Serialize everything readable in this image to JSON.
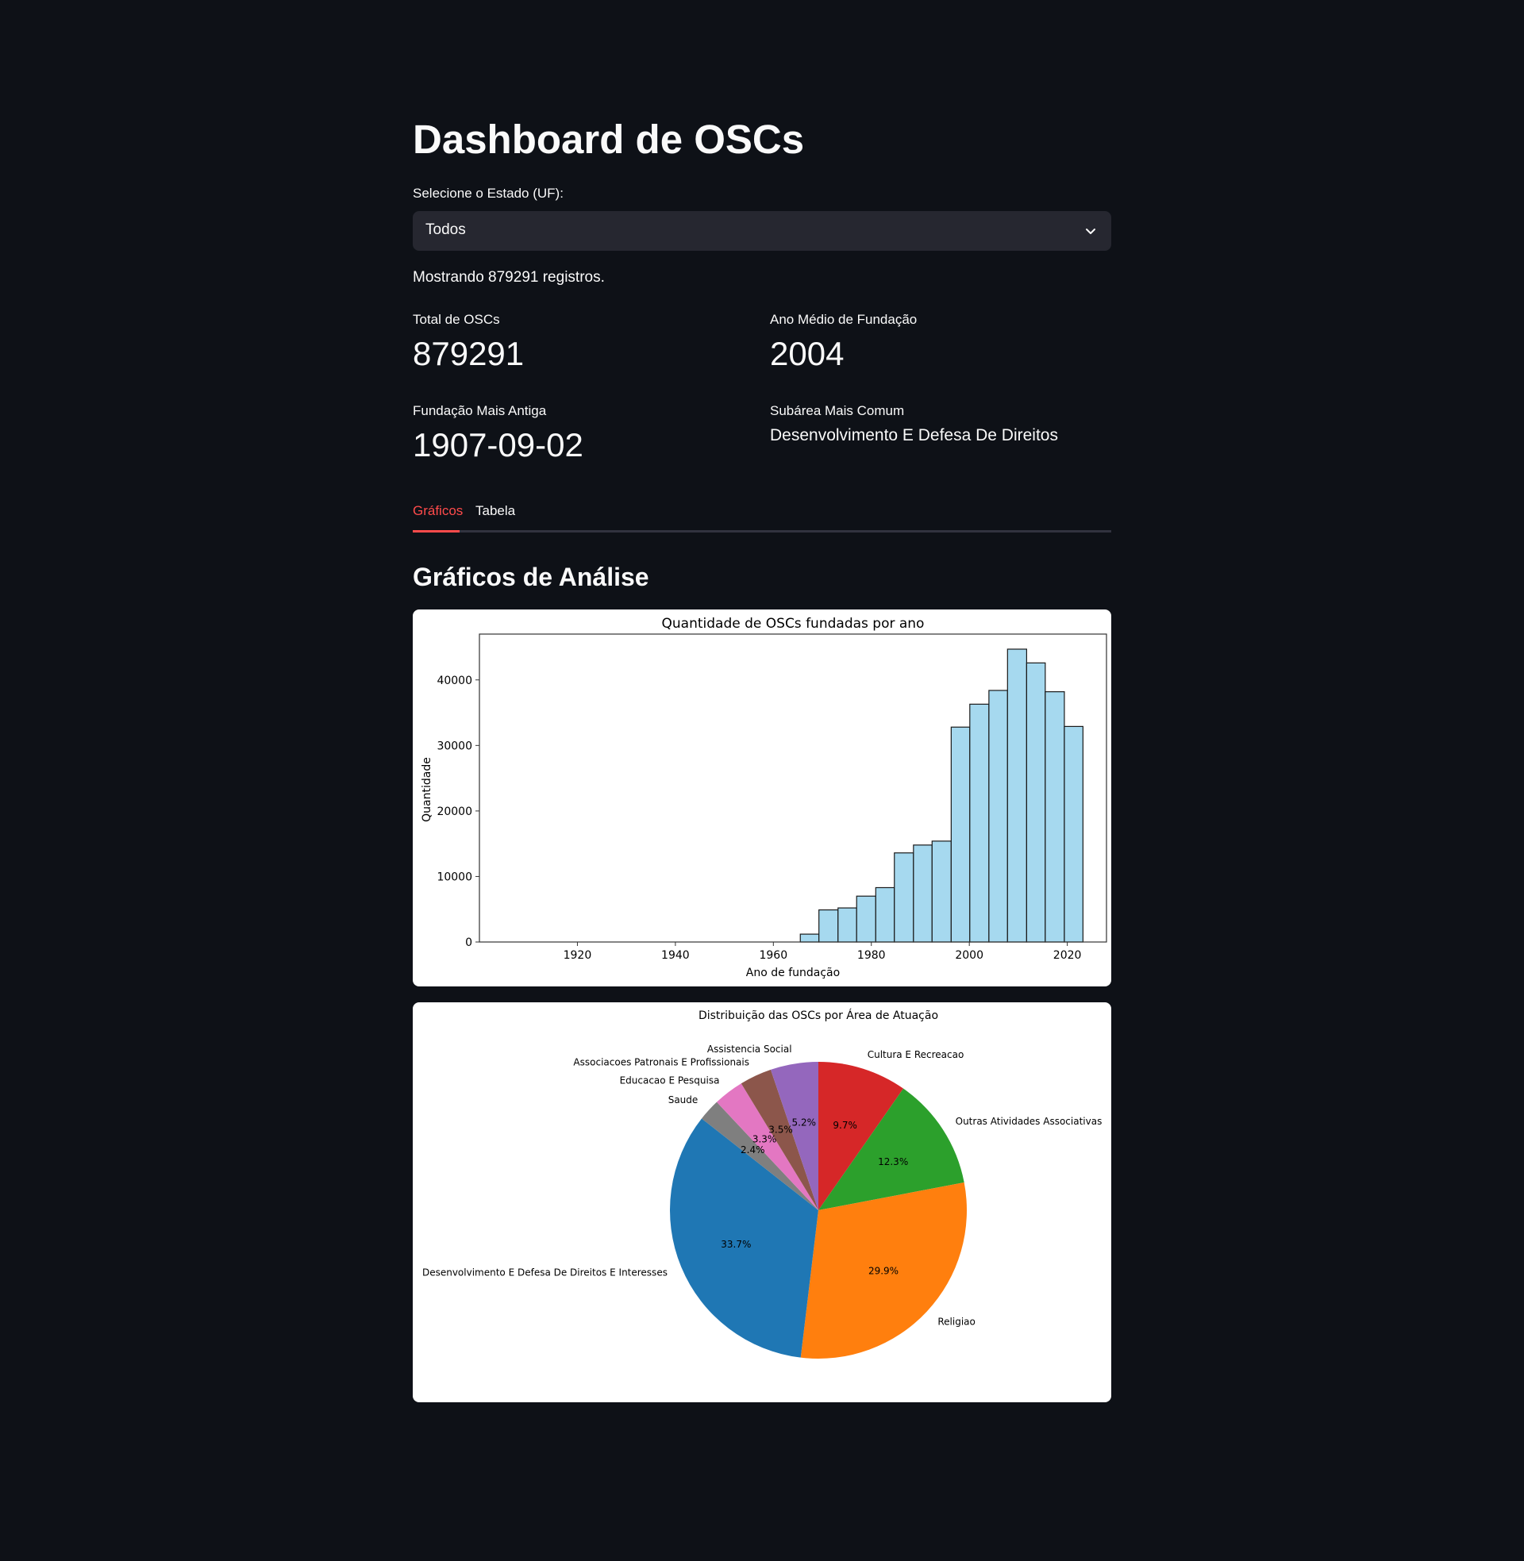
{
  "app": {
    "title": "Dashboard de OSCs"
  },
  "filter": {
    "label": "Selecione o Estado (UF):",
    "selected": "Todos"
  },
  "records_text": "Mostrando 879291 registros.",
  "metrics": {
    "total": {
      "label": "Total de OSCs",
      "value": "879291"
    },
    "avg_year": {
      "label": "Ano Médio de Fundação",
      "value": "2004"
    },
    "oldest": {
      "label": "Fundação Mais Antiga",
      "value": "1907-09-02"
    },
    "top_subarea": {
      "label": "Subárea Mais Comum",
      "value": "Desenvolvimento E Defesa De Direitos"
    }
  },
  "tabs": [
    {
      "label": "Gráficos",
      "active": true
    },
    {
      "label": "Tabela",
      "active": false
    }
  ],
  "section_title": "Gráficos de Análise",
  "colors": {
    "background": "#0e1117",
    "accent": "#ff4b4b",
    "select_bg": "#262730",
    "hist_bar": "#a6d9ef"
  },
  "chart_data": [
    {
      "type": "bar",
      "title": "Quantidade de OSCs fundadas por ano",
      "xlabel": "Ano de fundação",
      "ylabel": "Quantidade",
      "xlim": [
        1900,
        2028
      ],
      "ylim": [
        0,
        47000
      ],
      "xticks": [
        1920,
        1940,
        1960,
        1980,
        2000,
        2020
      ],
      "yticks": [
        0,
        10000,
        20000,
        30000,
        40000
      ],
      "bin_edges": [
        1907.7,
        1911.6,
        1915.4,
        1919.3,
        1923.1,
        1927,
        1930.8,
        1934.7,
        1938.5,
        1942.4,
        1946.2,
        1950.1,
        1953.9,
        1957.8,
        1961.6,
        1965.5,
        1969.3,
        1973.2,
        1977,
        1980.9,
        1984.7,
        1988.6,
        1992.4,
        1996.3,
        2000.1,
        2004,
        2007.8,
        2011.7,
        2015.5,
        2019.4,
        2023.2
      ],
      "values": [
        0,
        0,
        0,
        0,
        0,
        0,
        0,
        0,
        0,
        0,
        0,
        0,
        0,
        0,
        0,
        1200,
        4900,
        5200,
        7000,
        8300,
        13600,
        14800,
        15400,
        32800,
        36300,
        38400,
        44700,
        42600,
        38200,
        32900
      ],
      "grid": false
    },
    {
      "type": "pie",
      "title": "Distribuição das OSCs por Área de Atuação",
      "slices": [
        {
          "label": "Cultura E Recreacao",
          "value": 9.7,
          "pct_label": "9.7%",
          "color": "#d62728"
        },
        {
          "label": "Outras Atividades Associativas",
          "value": 12.3,
          "pct_label": "12.3%",
          "color": "#2ca02c"
        },
        {
          "label": "Religiao",
          "value": 29.9,
          "pct_label": "29.9%",
          "color": "#ff7f0e"
        },
        {
          "label": "Desenvolvimento E Defesa De Direitos E Interesses",
          "value": 33.7,
          "pct_label": "33.7%",
          "color": "#1f77b4"
        },
        {
          "label": "Saude",
          "value": 2.4,
          "pct_label": "2.4%",
          "color": "#7f7f7f"
        },
        {
          "label": "Educacao E Pesquisa",
          "value": 3.3,
          "pct_label": "3.3%",
          "color": "#e377c2"
        },
        {
          "label": "Associacoes Patronais E Profissionais",
          "value": 3.5,
          "pct_label": "3.5%",
          "color": "#8c564b"
        },
        {
          "label": "Assistencia Social",
          "value": 5.2,
          "pct_label": "5.2%",
          "color": "#9467bd"
        }
      ]
    }
  ]
}
